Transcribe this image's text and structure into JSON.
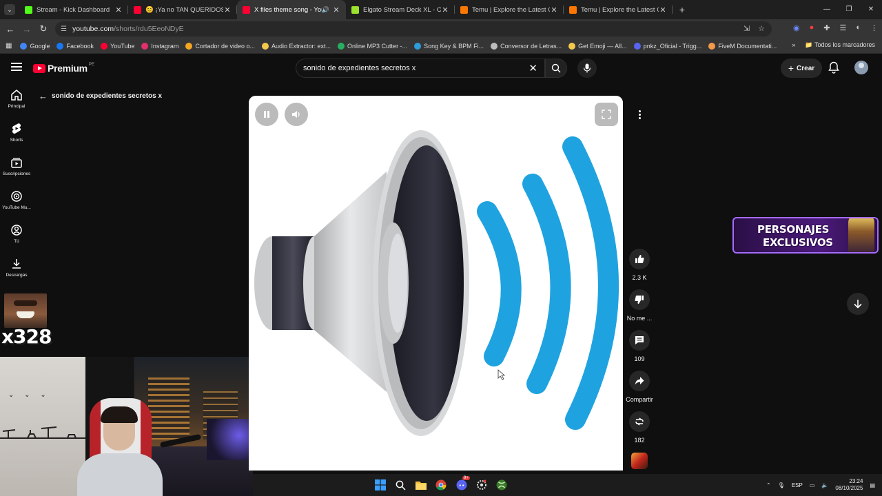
{
  "browser": {
    "tabs": [
      {
        "title": "Stream - Kick Dashboard",
        "color": "#53fc18"
      },
      {
        "title": "😊 ¡Ya no TAN QUERIDOS! 😡",
        "color": "#ff0033"
      },
      {
        "title": "X files theme song - YouTub",
        "color": "#ff0033",
        "active": true
      },
      {
        "title": "Elgato Stream Deck XL - Contro",
        "color": "#9be22d"
      },
      {
        "title": "Temu | Explore the Latest Cloth",
        "color": "#fb7701"
      },
      {
        "title": "Temu | Explore the Latest Cloth",
        "color": "#fb7701"
      }
    ],
    "url_host": "youtube.com",
    "url_path": "/shorts/rdu5EeoNDyE",
    "bookmarks": [
      {
        "label": "Google",
        "color": "#4285f4"
      },
      {
        "label": "Facebook",
        "color": "#1877f2"
      },
      {
        "label": "YouTube",
        "color": "#ff0033"
      },
      {
        "label": "Instagram",
        "color": "#e1306c"
      },
      {
        "label": "Cortador de video o...",
        "color": "#f4a623"
      },
      {
        "label": "Audio Extractor: ext...",
        "color": "#f2c94c"
      },
      {
        "label": "Online MP3 Cutter -...",
        "color": "#27ae60"
      },
      {
        "label": "Song Key & BPM Fi...",
        "color": "#2d9cdb"
      },
      {
        "label": "Conversor de Letras...",
        "color": "#bdbdbd"
      },
      {
        "label": "Get Emoji — All...",
        "color": "#f2c94c"
      },
      {
        "label": "pnkz_Oficial - Trigg...",
        "color": "#5865f2"
      },
      {
        "label": "FiveM Documentati...",
        "color": "#f2994a"
      }
    ],
    "all_bookmarks": "Todos los marcadores"
  },
  "youtube": {
    "logo_word": "Premium",
    "country_code": "PE",
    "search_value": "sonido de expedientes secretos x",
    "create_label": "Crear",
    "back_title": "sonido de expedientes secretos x",
    "rail": [
      {
        "label": "Principal",
        "icon": "home-icon"
      },
      {
        "label": "Shorts",
        "icon": "shorts-icon"
      },
      {
        "label": "Suscripciones",
        "icon": "subscriptions-icon"
      },
      {
        "label": "YouTube Mu...",
        "icon": "music-icon"
      },
      {
        "label": "Tú",
        "icon": "you-icon"
      },
      {
        "label": "Descargas",
        "icon": "download-icon"
      }
    ],
    "actions": {
      "likes": "2.3 K",
      "dislike": "No me ...",
      "comments": "109",
      "share": "Compartir",
      "remix": "182"
    }
  },
  "overlay": {
    "counter": "x328",
    "promo_line1": "PERSONAJES",
    "promo_line2": "EXCLUSIVOS"
  },
  "taskbar": {
    "lang": "ESP",
    "time": "23:24",
    "date": "08/10/2025",
    "discord_badge": "9+"
  },
  "colors": {
    "wave_blue": "#1fa3e0",
    "yt_red": "#ff0033"
  }
}
